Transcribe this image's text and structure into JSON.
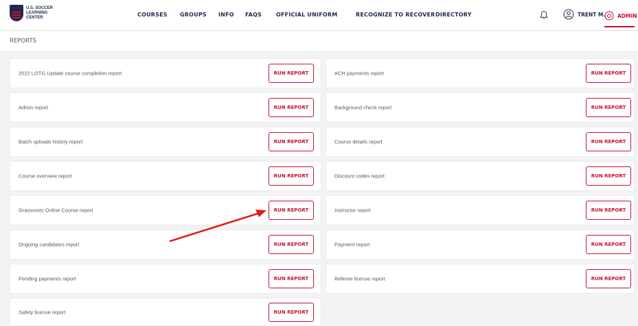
{
  "logo": {
    "line1": "U.S. SOCCER",
    "line2": "LEARNING",
    "line3": "CENTER"
  },
  "nav": {
    "items": [
      {
        "label": "COURSES"
      },
      {
        "label": "GROUPS"
      },
      {
        "label": "INFO"
      },
      {
        "label": "FAQS"
      },
      {
        "label": "OFFICIAL UNIFORM"
      },
      {
        "label": "RECOGNIZE TO RECOVER"
      },
      {
        "label": "DIRECTORY"
      }
    ]
  },
  "header": {
    "user_name": "TRENT M.",
    "admin_label": "ADMIN"
  },
  "page": {
    "title": "REPORTS"
  },
  "reports": {
    "button_label": "RUN REPORT",
    "left": [
      {
        "label": "2022 LOTG Update course completion report"
      },
      {
        "label": "Admin report"
      },
      {
        "label": "Batch uploads history report"
      },
      {
        "label": "Course overview report"
      },
      {
        "label": "Grassroots Online Course report"
      },
      {
        "label": "Ongoing candidates report"
      },
      {
        "label": "Pending payments report"
      },
      {
        "label": "Safety license report"
      }
    ],
    "right": [
      {
        "label": "ACH payments report"
      },
      {
        "label": "Background check report"
      },
      {
        "label": "Course details report"
      },
      {
        "label": "Discount codes report"
      },
      {
        "label": "Instructor report"
      },
      {
        "label": "Payment report"
      },
      {
        "label": "Referee license report"
      }
    ]
  },
  "colors": {
    "accent": "#c8102e",
    "navy": "#1f2a4d",
    "annotation_arrow": "#e01b1b"
  }
}
